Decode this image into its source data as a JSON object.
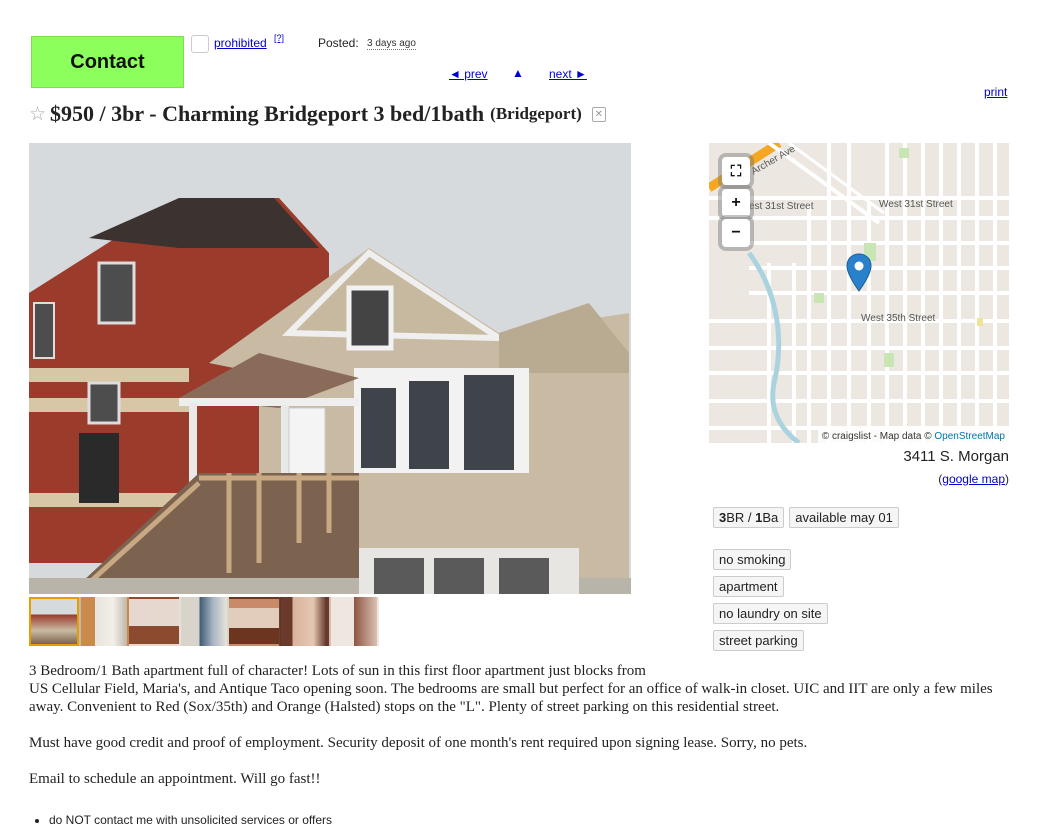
{
  "header": {
    "contact_label": "Contact",
    "prohibited_label": "prohibited",
    "prohibited_help": "[?]",
    "posted_label": "Posted:",
    "posted_date": "3 days ago",
    "prev_label": "◄ prev",
    "up_label": "▲",
    "next_label": "next ►",
    "print_label": "print"
  },
  "title": {
    "star_icon": "star-icon",
    "text": "$950 / 3br - Charming Bridgeport 3 bed/1bath",
    "neighborhood": "(Bridgeport)",
    "hide_icon": "hide-icon"
  },
  "gallery": {
    "thumb_count": 7,
    "active_index": 0
  },
  "map": {
    "street_labels": [
      "Archer Ave",
      "est 31st Street",
      "West 31st Street",
      "West 35th Street"
    ],
    "zoom_in": "+",
    "zoom_out": "−",
    "fullscreen": "⛶",
    "attribution_prefix": "© craigslist - Map data ©",
    "attribution_link": "OpenStreetMap",
    "address": "3411 S. Morgan",
    "google_map_label": "google map"
  },
  "attributes": {
    "bedrooms": "3",
    "br_suffix": "BR / ",
    "bathrooms": "1",
    "ba_suffix": "Ba",
    "available": "available may 01",
    "tags": [
      "no smoking",
      "apartment",
      "no laundry on site",
      "street parking"
    ]
  },
  "body": {
    "para1_line1": "3 Bedroom/1 Bath apartment full of character! Lots of sun in this first floor apartment just blocks from",
    "para1_rest": "US Cellular Field, Maria's, and Antique Taco opening soon. The bedrooms are small but perfect for an office of walk-in closet. UIC and IIT are only a few miles away. Convenient to Red (Sox/35th) and Orange (Halsted) stops on the \"L\". Plenty of street parking on this residential street.",
    "para2": "Must have good credit and proof of employment. Security deposit of one month's rent required upon signing lease. Sorry, no pets.",
    "para3": "Email to schedule an appointment. Will go fast!!",
    "notice": "do NOT contact me with unsolicited services or offers"
  }
}
